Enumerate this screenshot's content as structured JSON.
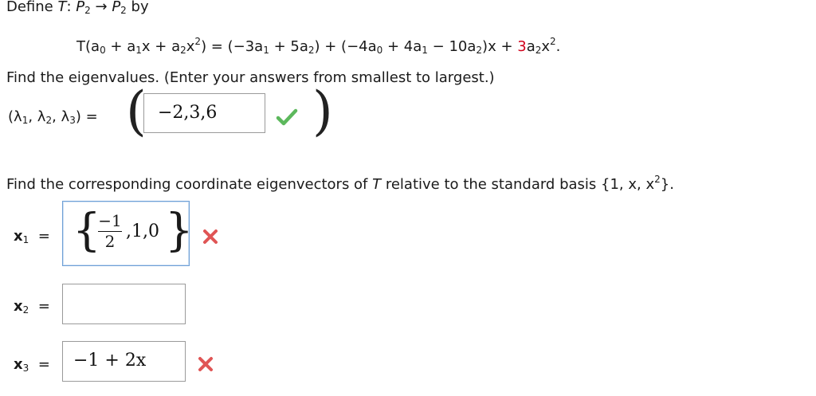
{
  "problem": {
    "define_prefix": "Define ",
    "T": "T",
    "map_colon": ": ",
    "P2_a": "P",
    "P2_a_sub": "2",
    "arrow": " → ",
    "P2_b": "P",
    "P2_b_sub": "2",
    "by": " by",
    "equation_lhs": "T(a",
    "eq_lhs_parts": {
      "a0": "0",
      "plus_a1": " + a",
      "a1": "1",
      "x_plus_a2": "x + a",
      "a2": "2",
      "x2": "x",
      "x2_sup": "2",
      "close": ") = (−3a"
    },
    "eq_rhs_parts": {
      "p1_sub": "1",
      "p1_mid": " + 5a",
      "p1_sub2": "2",
      "p2_open": ") + (−4a",
      "p2_sub0": "0",
      "p2_mid": " + 4a",
      "p2_sub1": "1",
      "p2_mid2": " − 10a",
      "p2_sub2": "2",
      "p2_close": ")x + ",
      "red_coef": "3",
      "tail": "a",
      "tail_sub": "2",
      "tail_x": "x",
      "tail_sup": "2",
      "period": "."
    }
  },
  "eigenvalues": {
    "prompt": "Find the eigenvalues. (Enter your answers from smallest to largest.)",
    "label_open": "(λ",
    "l1": "1",
    "l2_prefix": ", λ",
    "l2": "2",
    "l3_prefix": ", λ",
    "l3": "3",
    "label_close": ") =",
    "answer_value": "−2,3,6",
    "status": "correct"
  },
  "eigenvectors": {
    "prompt_pre": "Find the corresponding coordinate eigenvectors of ",
    "prompt_T": "T",
    "prompt_post": " relative to the standard basis ",
    "basis_open": "{1, x, x",
    "basis_sup": "2",
    "basis_close": "}.",
    "rows": [
      {
        "label": "x",
        "sub": "1",
        "eq": "=",
        "frac_num": "−1",
        "frac_den": "2",
        "rest": ",1,0",
        "status": "incorrect"
      },
      {
        "label": "x",
        "sub": "2",
        "eq": "=",
        "value": "",
        "status": "empty"
      },
      {
        "label": "x",
        "sub": "3",
        "eq": "=",
        "value": "−1 + 2x",
        "status": "incorrect"
      }
    ]
  },
  "colors": {
    "check_green": "#5cb85c",
    "cross_red": "#e05555",
    "coef_red": "#d0021b",
    "input_border": "#9a9a9a",
    "focus_border": "#6ea0d6"
  },
  "icons": {
    "correct": "check-icon",
    "incorrect": "cross-icon"
  }
}
